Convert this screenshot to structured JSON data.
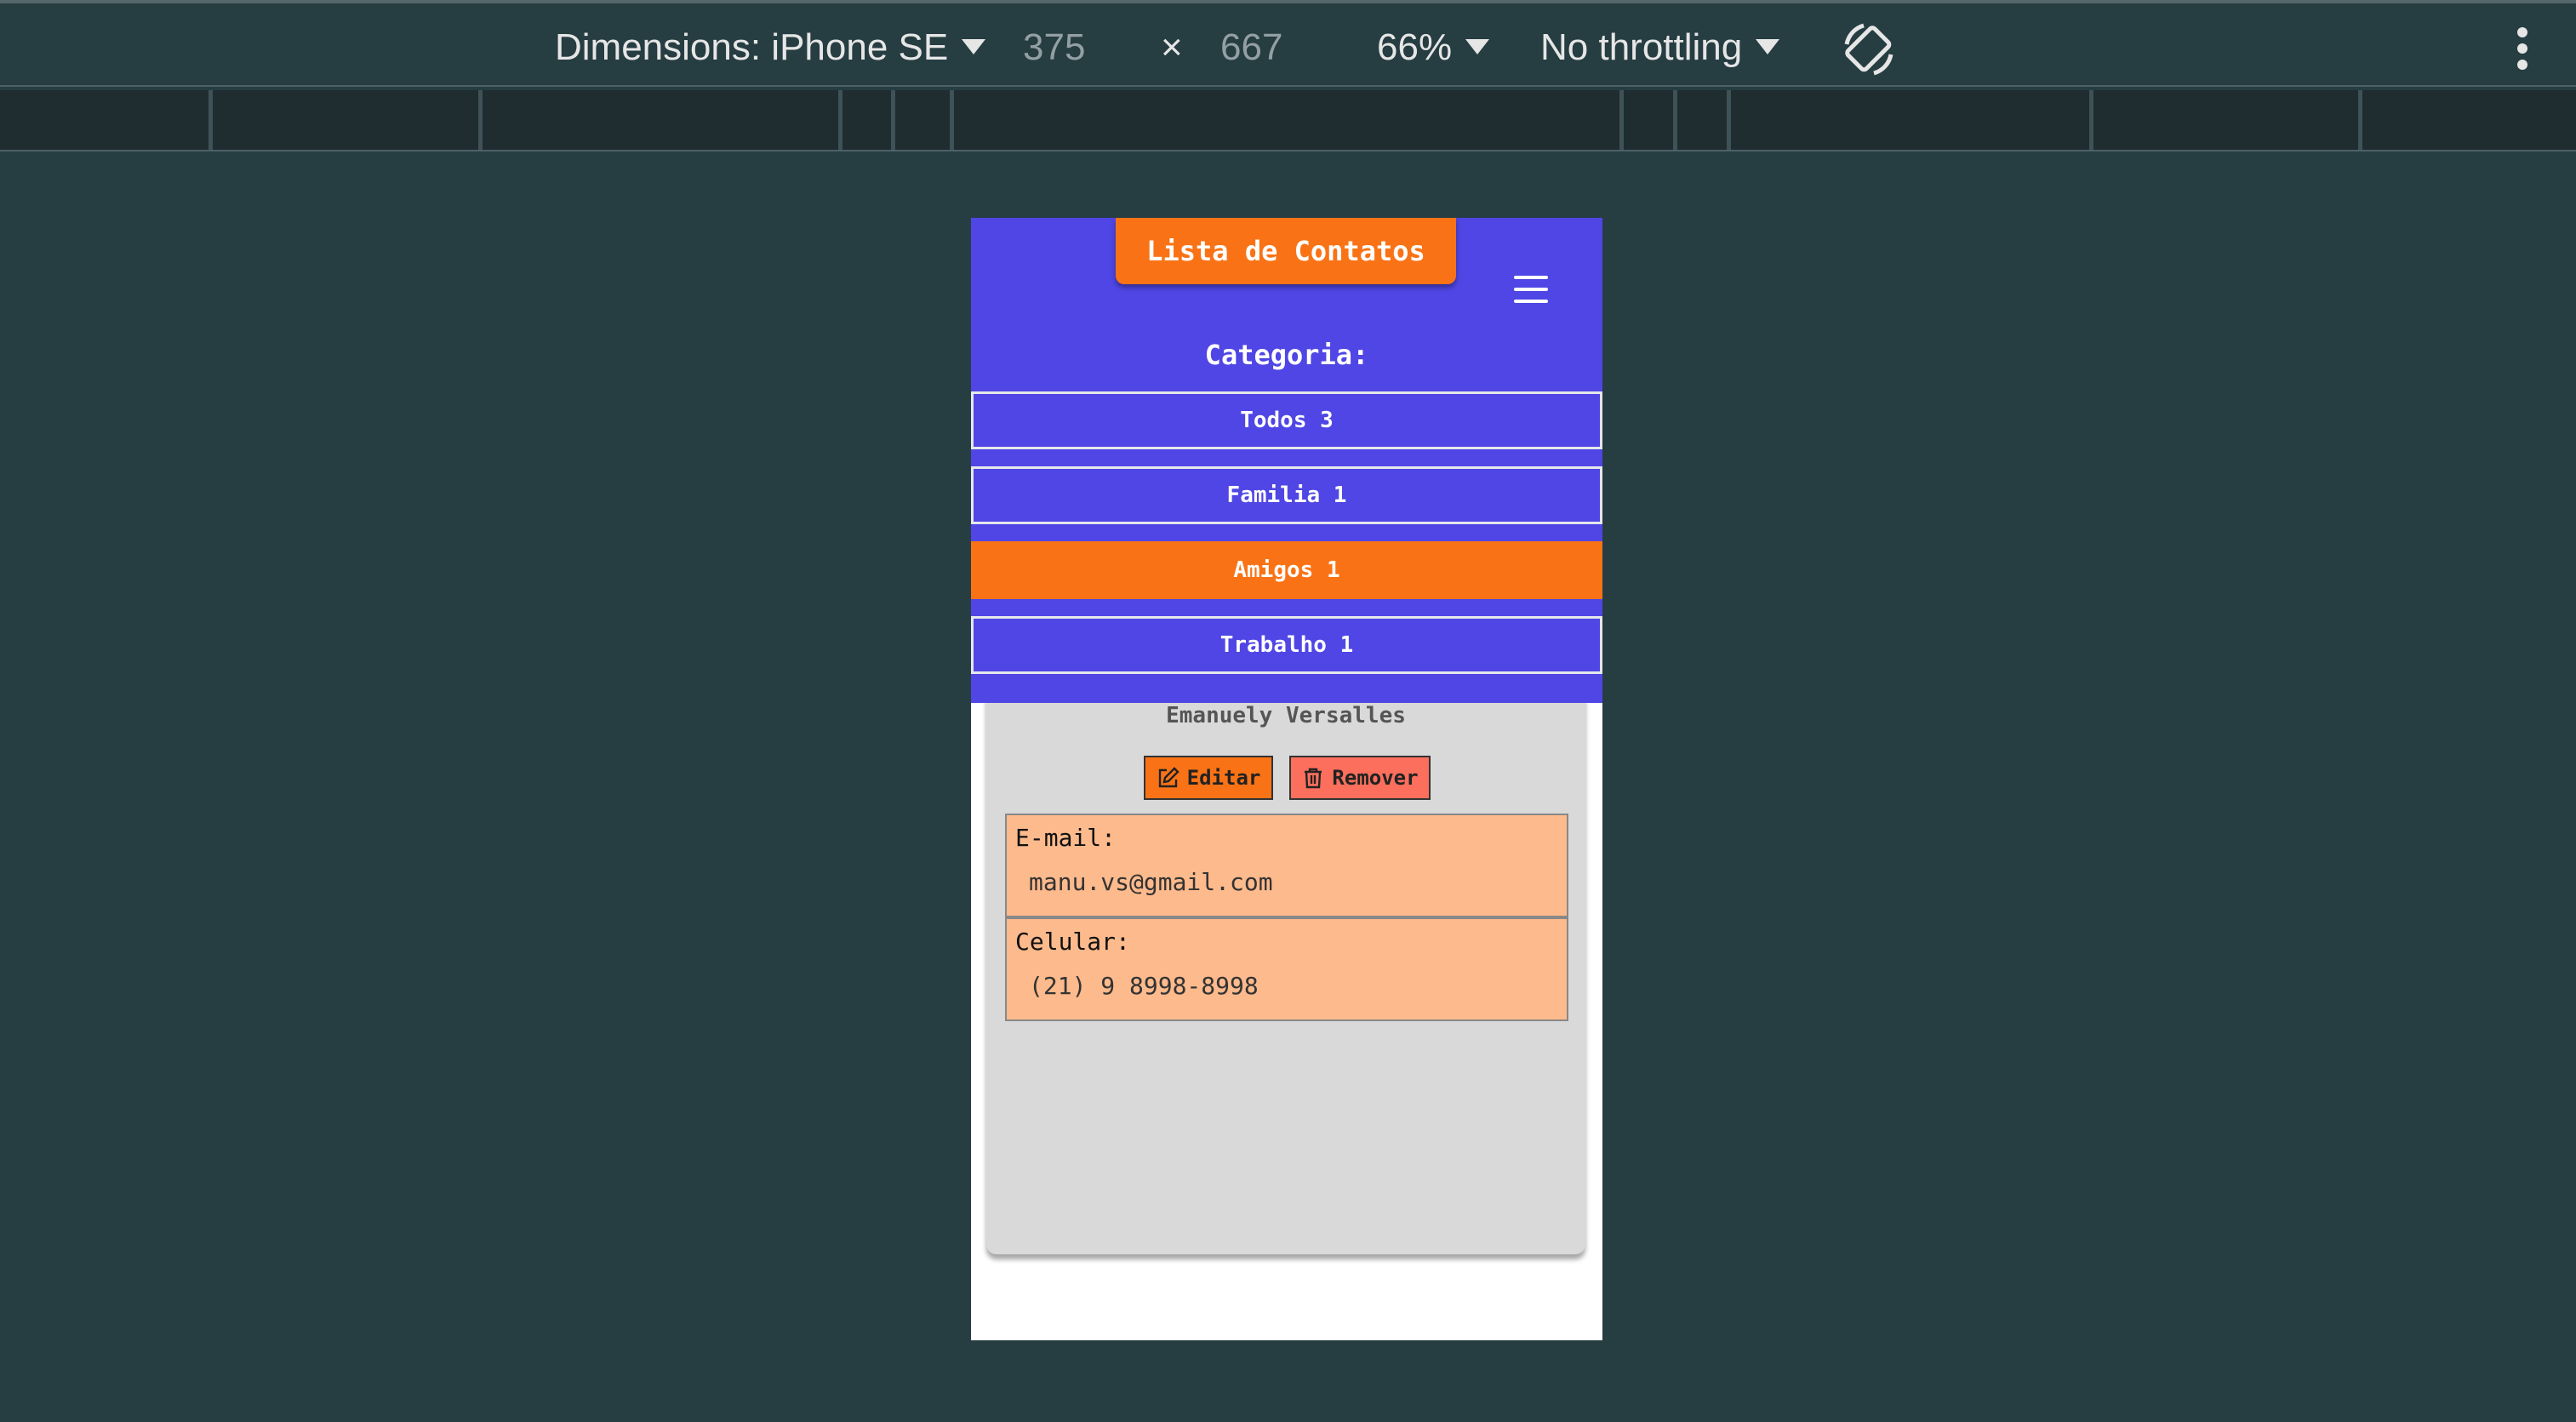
{
  "devtools": {
    "dimensions_label": "Dimensions: iPhone SE",
    "width": "375",
    "times": "×",
    "height": "667",
    "zoom": "66%",
    "throttling": "No throttling"
  },
  "app": {
    "title": "Lista de Contatos",
    "category_label": "Categoria:",
    "categories": [
      {
        "label": "Todos 3",
        "active": false
      },
      {
        "label": "Familia 1",
        "active": false
      },
      {
        "label": "Amigos 1",
        "active": true
      },
      {
        "label": "Trabalho 1",
        "active": false
      }
    ],
    "contact": {
      "name": "Emanuely Versalles",
      "edit_label": "Editar",
      "remove_label": "Remover",
      "email_label": "E-mail:",
      "email": "manu.vs@gmail.com",
      "phone_label": "Celular:",
      "phone": "(21) 9 8998-8998"
    }
  },
  "colors": {
    "header": "#4f46e5",
    "accent": "#f97316",
    "remove": "#fb6f5c",
    "info_bg": "#fdba8c"
  }
}
